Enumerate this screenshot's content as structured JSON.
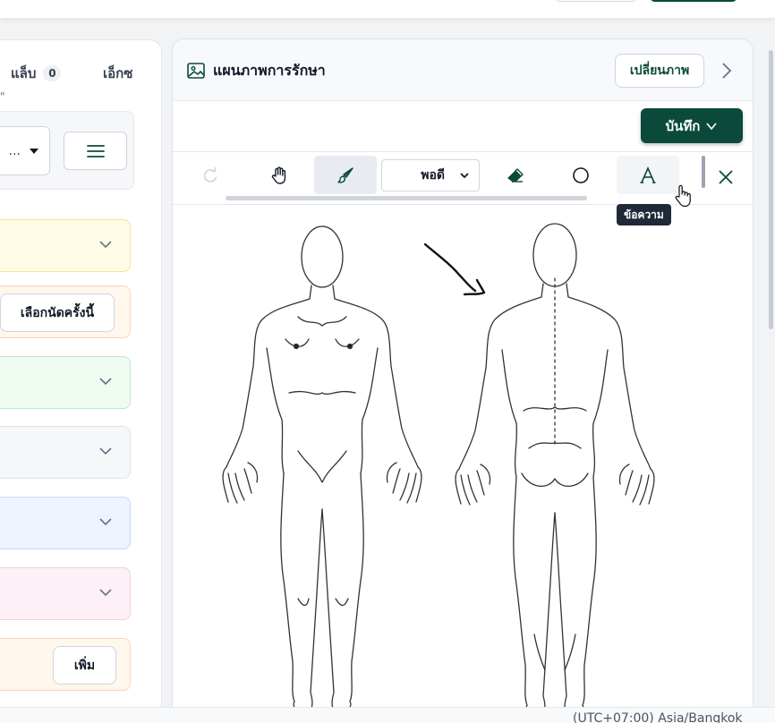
{
  "left_panel": {
    "tab_lab": {
      "label": "แล็บ",
      "count": "0"
    },
    "tab_xray": "เอ็กซ",
    "tab_hint": "\"",
    "filter_select_value": "...",
    "cards": {
      "orange_button": "เลือกนัดครั้งนี้",
      "peach_button": "เพิ่ม"
    }
  },
  "right_panel": {
    "title": "แผนภาพการรักษา",
    "change_image_button": "เปลี่ยนภาพ",
    "save_button": "บันทึก",
    "toolbar": {
      "stroke_select_value": "พอดี",
      "text_tool_tooltip": "ข้อความ",
      "tools": [
        "redo-icon",
        "hand-icon",
        "brush-icon",
        "eraser-icon",
        "circle-icon",
        "text-icon"
      ]
    }
  },
  "footer": {
    "timezone": "(UTC+07:00) Asia/Bangkok"
  },
  "colors": {
    "primary": "#0b4a3a",
    "yellow_card": "#fffbe6",
    "orange_card": "#fff6ec",
    "green_card": "#effbf1",
    "gray_card": "#f6f7f9",
    "blue_card": "#eef4ff",
    "pink_card": "#fdf0f6"
  }
}
